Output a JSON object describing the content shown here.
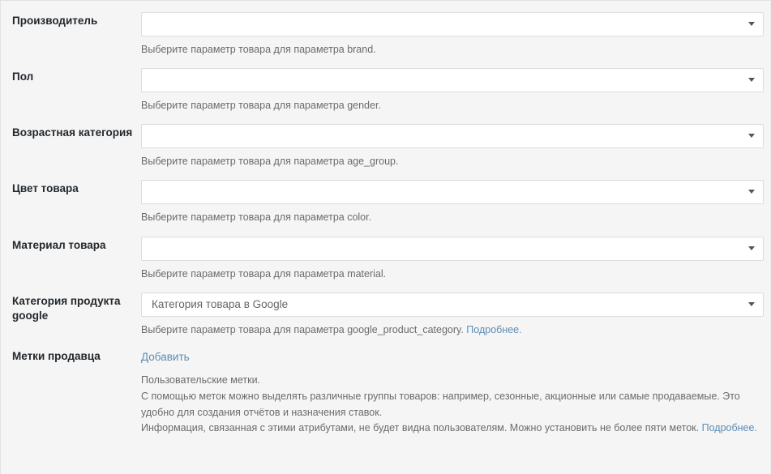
{
  "form": {
    "rows": [
      {
        "id": "brand",
        "label": "Производитель",
        "control": "select",
        "value": "",
        "help": "Выберите параметр товара для параметра brand."
      },
      {
        "id": "gender",
        "label": "Пол",
        "control": "select",
        "value": "",
        "help": "Выберите параметр товара для параметра gender."
      },
      {
        "id": "age_group",
        "label": "Возрастная категория",
        "control": "select",
        "value": "",
        "help": "Выберите параметр товара для параметра age_group."
      },
      {
        "id": "color",
        "label": "Цвет товара",
        "control": "select",
        "value": "",
        "help": "Выберите параметр товара для параметра color."
      },
      {
        "id": "material",
        "label": "Материал товара",
        "control": "select",
        "value": "",
        "help": "Выберите параметр товара для параметра material."
      },
      {
        "id": "google_product_category",
        "label": "Категория продукта google",
        "control": "select",
        "value": "Категория товара в Google",
        "help": "Выберите параметр товара для параметра google_product_category.",
        "help_link": "Подробнее.",
        "help_link_prefix": "Выберите параметр товара для параметра google_product_category. "
      },
      {
        "id": "custom_labels",
        "label": "Метки продавца",
        "control": "link",
        "add_label": "Добавить",
        "description_lines": [
          "Пользовательские метки.",
          "С помощью меток можно выделять различные группы товаров: например, сезонные, акционные или самые продаваемые. Это удобно для создания отчётов и назначения ставок.",
          "Информация, связанная с этими атрибутами, не будет видна пользователям. Можно установить не более пяти меток."
        ],
        "description_link": "Подробнее."
      }
    ]
  },
  "icons": {
    "dropdown_arrow": "chevron-down-icon"
  },
  "colors": {
    "background": "#f5f5f5",
    "label_text": "#23282d",
    "help_text": "#6b6b6b",
    "link": "#5d8cb3",
    "field_border": "#dddddd",
    "field_background": "#ffffff"
  }
}
